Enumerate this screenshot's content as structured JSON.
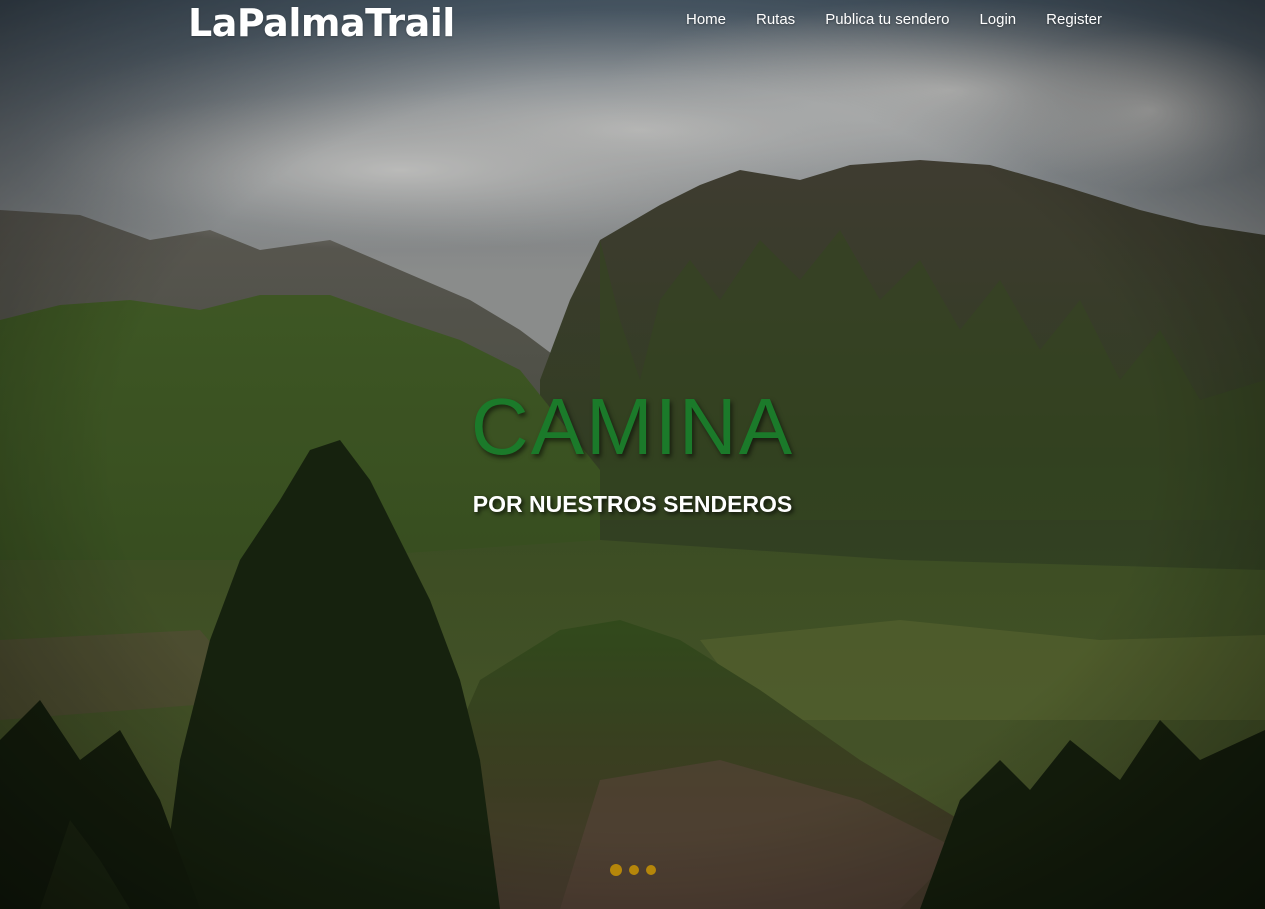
{
  "brand": {
    "name": "LaPalmaTrail"
  },
  "nav": {
    "items": [
      {
        "label": "Home"
      },
      {
        "label": "Rutas"
      },
      {
        "label": "Publica tu sendero"
      },
      {
        "label": "Login"
      },
      {
        "label": "Register"
      }
    ]
  },
  "hero": {
    "title": "CAMINA",
    "subtitle": "POR NUESTROS SENDEROS",
    "slide_count": 3,
    "active_slide": 1
  },
  "colors": {
    "title": "#1b7a2a",
    "indicator": "#b5860a",
    "nav_text": "#ffffff"
  }
}
